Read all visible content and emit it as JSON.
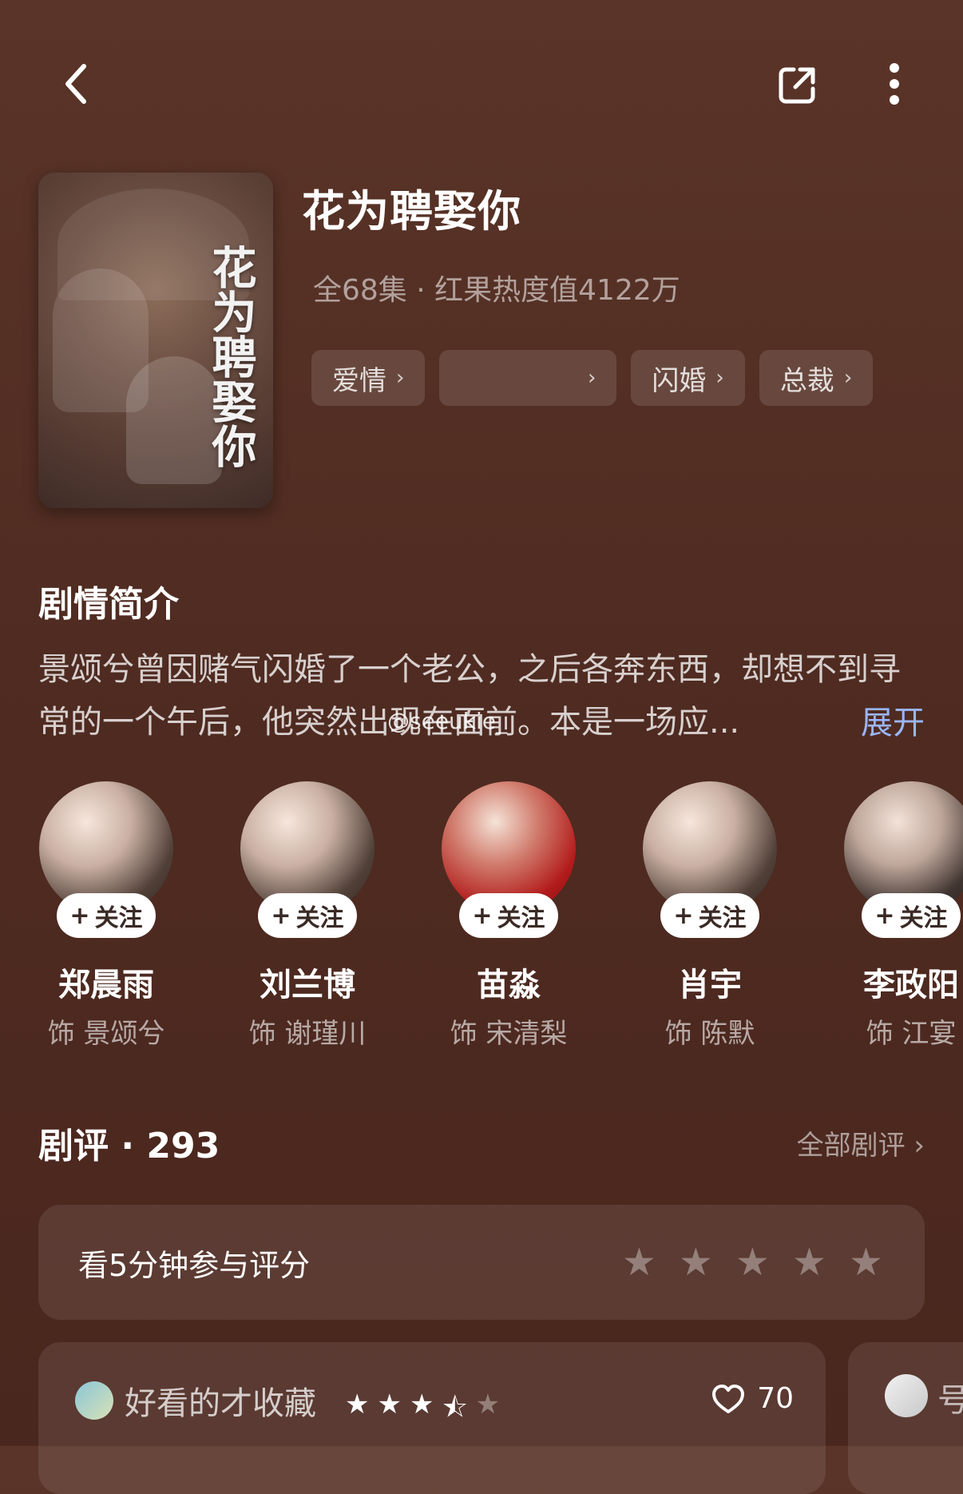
{
  "topbar": {
    "back_icon": "chevron-left-icon",
    "share_icon": "share-icon",
    "more_icon": "more-vertical-icon"
  },
  "show": {
    "poster_title": "花为聘娶你",
    "title": "花为聘娶你",
    "meta": "全68集 · 红果热度值4122万",
    "tags": [
      {
        "label": "爱情"
      },
      {
        "label": ""
      },
      {
        "label": "闪婚"
      },
      {
        "label": "总裁"
      }
    ]
  },
  "synopsis": {
    "title": "剧情简介",
    "text": "景颂兮曾因赌气闪婚了一个老公，之后各奔东西，却想不到寻常的一个午后，他突然出现在面前。本是一场应...",
    "expand": "展开",
    "watermark": "@seeukie_"
  },
  "cast": [
    {
      "follow": "关注",
      "name": "郑晨雨",
      "role": "饰 景颂兮"
    },
    {
      "follow": "关注",
      "name": "刘兰博",
      "role": "饰 谢瑾川"
    },
    {
      "follow": "关注",
      "name": "苗淼",
      "role": "饰 宋清梨"
    },
    {
      "follow": "关注",
      "name": "肖宇",
      "role": "饰 陈默"
    },
    {
      "follow": "关注",
      "name": "李政阳",
      "role": "饰 江宴"
    }
  ],
  "reviews": {
    "title": "剧评 · 293",
    "all": "全部剧评",
    "rate_prompt": "看5分钟参与评分",
    "review1": {
      "name": "好看的才收藏",
      "rating": 3.5,
      "likes": "70"
    },
    "review2": {
      "name": "号"
    }
  },
  "colors": {
    "accent": "#9ab6ff"
  }
}
